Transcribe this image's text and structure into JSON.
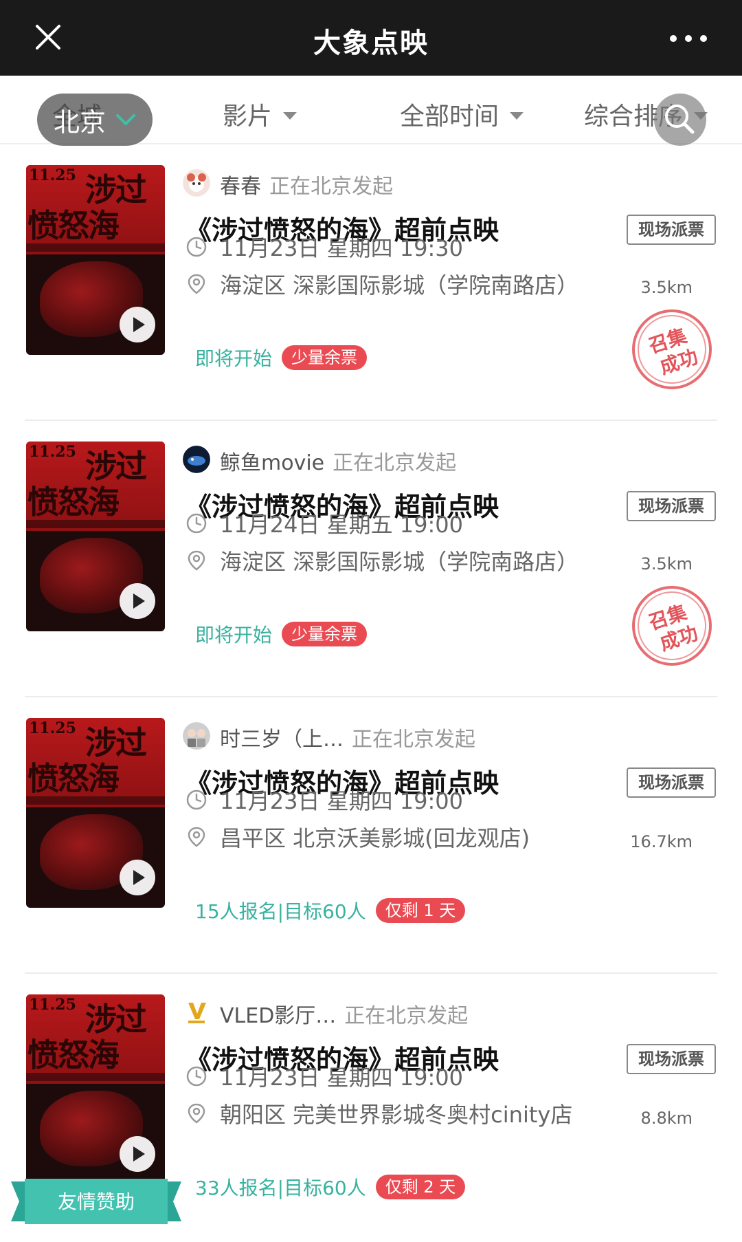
{
  "header": {
    "title": "大象点映"
  },
  "filters": {
    "city": "北京",
    "city_hint": "全城",
    "film": "影片",
    "time": "全部时间",
    "sort": "综合排序"
  },
  "colors": {
    "topbar": "#1a1a1a",
    "accent_teal": "#38b2a0",
    "badge_red": "#ea4b53",
    "stamp_red": "#e2555a"
  },
  "cards": [
    {
      "organizer": "春春",
      "initiated": "正在北京发起",
      "title": "《涉过愤怒的海》超前点映",
      "tag": "现场派票",
      "datetime": "11月23日  星期四 19:30",
      "location": "海淀区  深影国际影城（学院南路店）",
      "distance": "3.5km",
      "status": "即将开始",
      "badge": "少量余票",
      "stamp": [
        "召集",
        "成功"
      ],
      "poster": {
        "date": "11.25",
        "text1": "涉过",
        "text2": "愤怒海"
      },
      "avatar_icon": "dog-avatar-icon"
    },
    {
      "organizer": "鲸鱼movie",
      "initiated": "正在北京发起",
      "title": "《涉过愤怒的海》超前点映",
      "tag": "现场派票",
      "datetime": "11月24日  星期五 19:00",
      "location": "海淀区  深影国际影城（学院南路店）",
      "distance": "3.5km",
      "status": "即将开始",
      "badge": "少量余票",
      "stamp": [
        "召集",
        "成功"
      ],
      "poster": {
        "date": "11.25",
        "text1": "涉过",
        "text2": "愤怒海"
      },
      "avatar_icon": "whale-avatar-icon"
    },
    {
      "organizer": "时三岁（上…",
      "initiated": "正在北京发起",
      "title": "《涉过愤怒的海》超前点映",
      "tag": "现场派票",
      "datetime": "11月23日  星期四 19:00",
      "location": "昌平区  北京沃美影城(回龙观店)",
      "distance": "16.7km",
      "status": "15人报名|目标60人",
      "badge": "仅剩 1 天",
      "poster": {
        "date": "11.25",
        "text1": "涉过",
        "text2": "愤怒海"
      },
      "avatar_icon": "people-avatar-icon"
    },
    {
      "organizer": "VLED影厅…",
      "initiated": "正在北京发起",
      "title": "《涉过愤怒的海》超前点映",
      "tag": "现场派票",
      "datetime": "11月23日  星期四 19:00",
      "location": "朝阳区  完美世界影城冬奥村cinity店",
      "distance": "8.8km",
      "status": "33人报名|目标60人",
      "badge": "仅剩 2 天",
      "poster": {
        "date": "11.25",
        "text1": "涉过",
        "text2": "愤怒海"
      },
      "avatar_icon": "vled-logo-icon"
    }
  ],
  "sponsor_ribbon": "友情赞助"
}
